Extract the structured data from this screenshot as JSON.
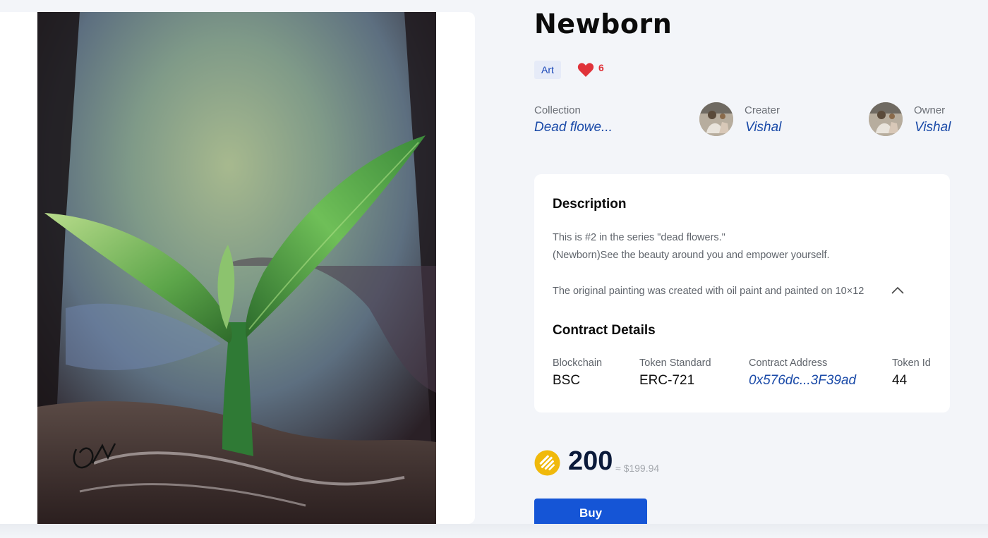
{
  "item": {
    "title": "Newborn",
    "category_tag": "Art",
    "likes": "6"
  },
  "meta": {
    "collection_label": "Collection",
    "collection_value": "Dead flowe...",
    "creator_label": "Creater",
    "creator_value": "Vishal",
    "owner_label": "Owner",
    "owner_value": "Vishal"
  },
  "description": {
    "heading": "Description",
    "line1": "This is #2 in the series \"dead flowers.\"",
    "line2": "(Newborn)See the beauty around you and empower yourself.",
    "line3": "The original painting was created with oil paint and painted on 10×12"
  },
  "contract": {
    "heading": "Contract Details",
    "blockchain_label": "Blockchain",
    "blockchain_value": "BSC",
    "standard_label": "Token Standard",
    "standard_value": "ERC-721",
    "address_label": "Contract Address",
    "address_value": "0x576dc...3F39ad",
    "token_label": "Token Id",
    "token_value": "44"
  },
  "price": {
    "amount": "200",
    "usd": "≈ $199.94",
    "coin_icon": "busd-coin-icon"
  },
  "actions": {
    "buy_label": "Buy"
  },
  "colors": {
    "accent": "#1555d6",
    "link": "#1a4aa8",
    "like": "#e0333a",
    "coin": "#f0b90b"
  }
}
